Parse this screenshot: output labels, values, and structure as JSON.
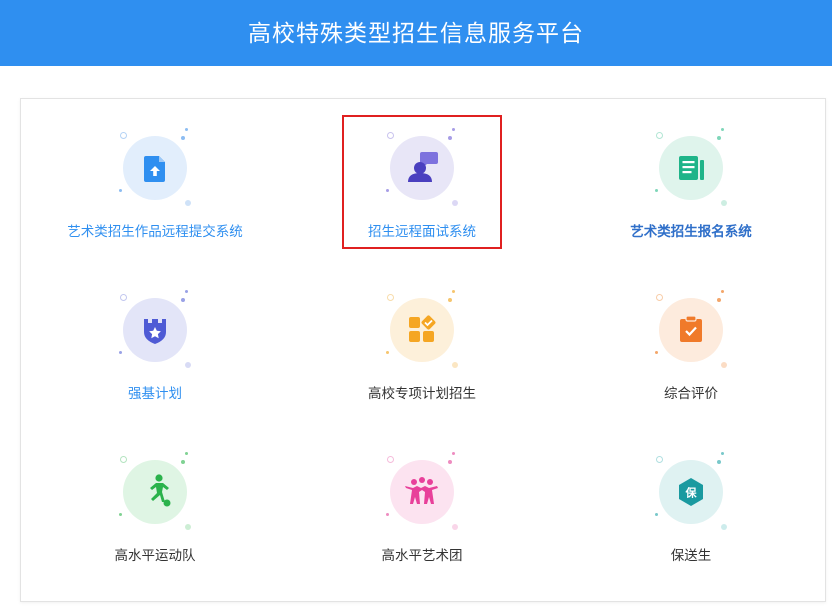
{
  "header": {
    "title": "高校特殊类型招生信息服务平台"
  },
  "items": [
    {
      "label": "艺术类招生作品远程提交系统",
      "icon": "upload-document-icon",
      "color": "#2f8ff0"
    },
    {
      "label": "招生远程面试系统",
      "icon": "video-interview-icon",
      "color": "#5b4fcf"
    },
    {
      "label": "艺术类招生报名系统",
      "icon": "registration-form-icon",
      "color": "#1fb489"
    },
    {
      "label": "强基计划",
      "icon": "shield-star-icon",
      "color": "#4f5bd5"
    },
    {
      "label": "高校专项计划招生",
      "icon": "grid-check-icon",
      "color": "#f5a623"
    },
    {
      "label": "综合评价",
      "icon": "clipboard-check-icon",
      "color": "#f07a2a"
    },
    {
      "label": "高水平运动队",
      "icon": "soccer-player-icon",
      "color": "#2bb24c"
    },
    {
      "label": "高水平艺术团",
      "icon": "dancers-icon",
      "color": "#e8409a"
    },
    {
      "label": "保送生",
      "icon": "guarantee-badge-icon",
      "color": "#1a9aa0"
    }
  ]
}
